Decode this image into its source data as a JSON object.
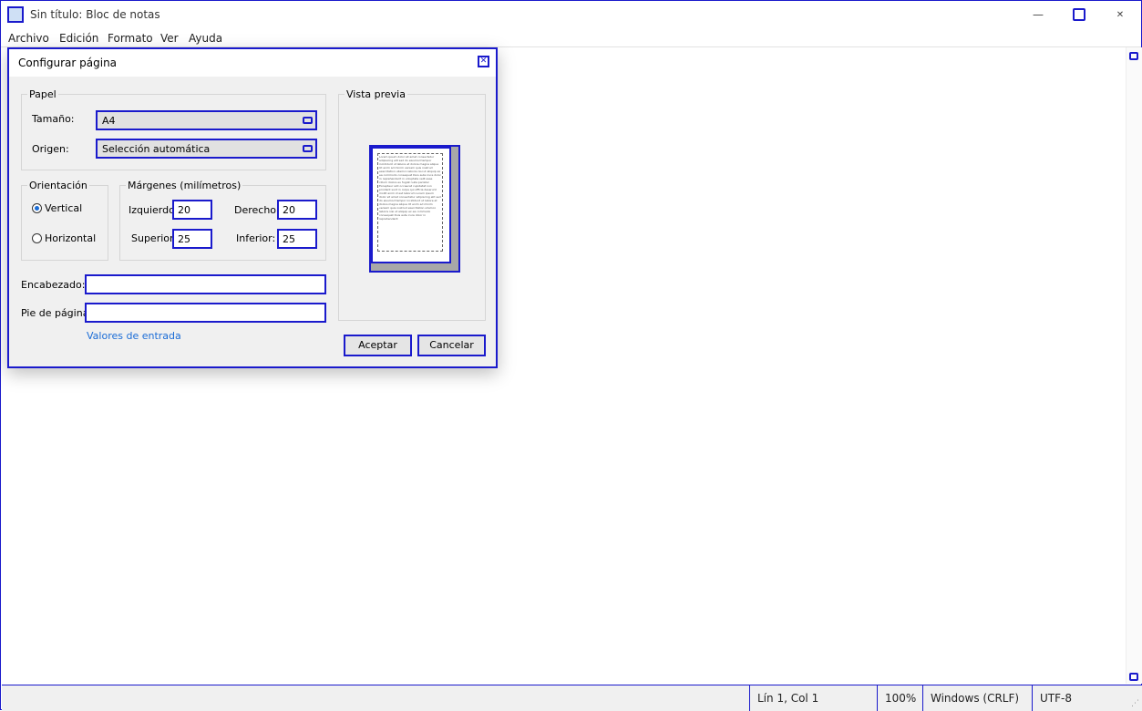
{
  "window": {
    "title": "Sin título: Bloc de notas",
    "min_glyph": "—",
    "close_glyph": "✕"
  },
  "menu": [
    "Archivo",
    "Edición",
    "Formato",
    "Ver",
    "Ayuda"
  ],
  "dialog": {
    "title": "Configurar página",
    "close_glyph": "✕",
    "paper": {
      "group_label": "Papel",
      "size_label": "Tamaño:",
      "size_value": "A4",
      "source_label": "Origen:",
      "source_value": "Selección automática"
    },
    "orientation": {
      "group_label": "Orientación",
      "vertical": "Vertical",
      "horizontal": "Horizontal",
      "selected": "vertical"
    },
    "margins": {
      "group_label": "Márgenes (milímetros)",
      "left_label": "Izquierdo:",
      "left_value": "20",
      "right_label": "Derecho:",
      "right_value": "20",
      "top_label": "Superior:",
      "top_value": "25",
      "bottom_label": "Inferior:",
      "bottom_value": "25"
    },
    "preview": {
      "group_label": "Vista previa",
      "sample_text": "Lorem ipsum dolor sit amet consectetur adipiscing elit sed do eiusmod tempor incididunt ut labore et dolore magna aliqua Ut enim ad minim veniam quis nostrud exercitation ullamco laboris nisi ut aliquip ex ea commodo consequat Duis aute irure dolor in reprehenderit in voluptate velit esse cillum dolore eu fugiat nulla pariatur Excepteur sint occaecat cupidatat non proident sunt in culpa qui officia deserunt mollit anim id est laborum Lorem ipsum dolor sit amet consectetur adipiscing elit sed do eiusmod tempor incididunt ut labore et dolore magna aliqua Ut enim ad minim veniam quis nostrud exercitation ullamco laboris nisi ut aliquip ex ea commodo consequat Duis aute irure dolor in reprehenderit"
    },
    "header_label": "Encabezado:",
    "header_value": "",
    "footer_label": "Pie de página:",
    "footer_value": "",
    "input_values_link": "Valores de entrada",
    "ok_label": "Aceptar",
    "cancel_label": "Cancelar"
  },
  "status": {
    "position": "Lín 1, Col 1",
    "zoom": "100%",
    "line_ending": "Windows (CRLF)",
    "encoding": "UTF-8"
  }
}
